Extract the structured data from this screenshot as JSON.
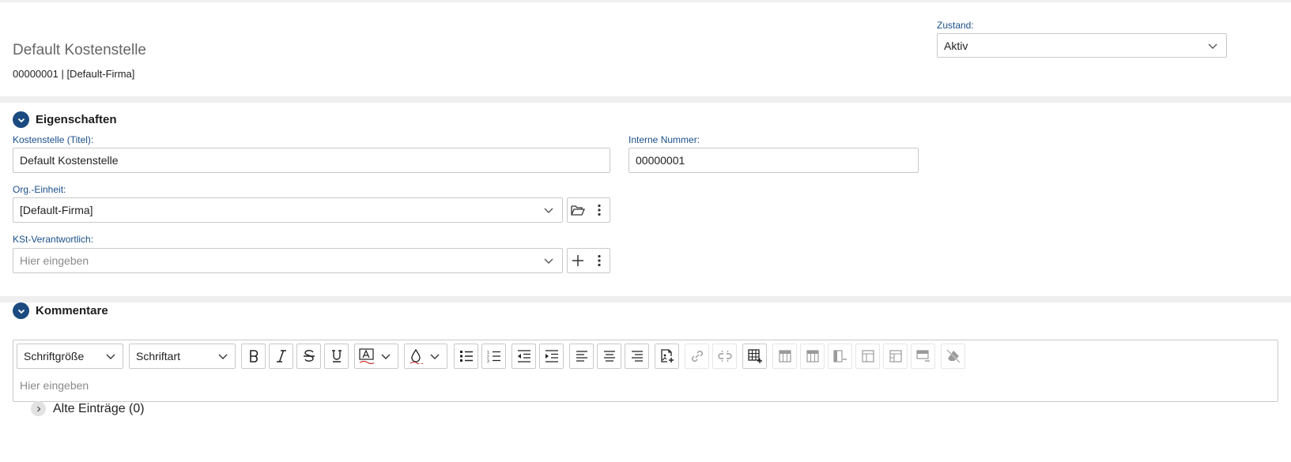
{
  "header": {
    "title": "Default Kostenstelle",
    "subtitle": "00000001 | [Default-Firma]",
    "status_label": "Zustand:",
    "status_value": "Aktiv"
  },
  "properties": {
    "section_title": "Eigenschaften",
    "title_label": "Kostenstelle (Titel):",
    "title_value": "Default Kostenstelle",
    "internal_label": "Interne Nummer:",
    "internal_value": "00000001",
    "org_label": "Org.-Einheit:",
    "org_value": "[Default-Firma]",
    "resp_label": "KSt-Verantwortlich:",
    "resp_placeholder": "Hier eingeben"
  },
  "comments": {
    "section_title": "Kommentare",
    "font_size_label": "Schriftgröße",
    "font_family_label": "Schriftart",
    "editor_placeholder": "Hier eingeben",
    "old_entries": "Alte Einträge (0)"
  },
  "colors": {
    "accent": "#1b4a80",
    "label": "#1a4f8a",
    "border": "#c9c9c9"
  }
}
